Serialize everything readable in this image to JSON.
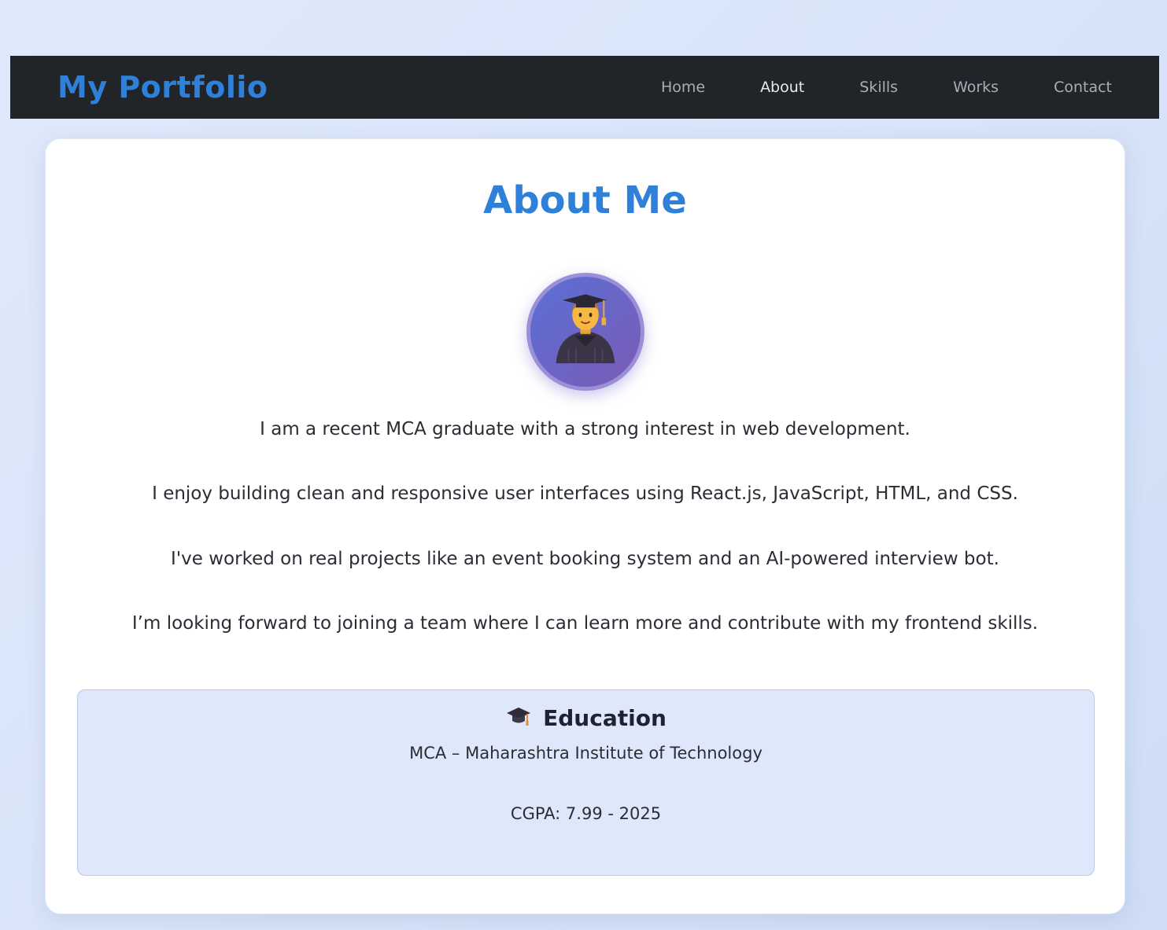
{
  "nav": {
    "brand": "My Portfolio",
    "links": [
      {
        "label": "Home",
        "active": false
      },
      {
        "label": "About",
        "active": true
      },
      {
        "label": "Skills",
        "active": false
      },
      {
        "label": "Works",
        "active": false
      },
      {
        "label": "Contact",
        "active": false
      }
    ]
  },
  "about": {
    "title": "About Me",
    "avatar_icon": "graduate-avatar-icon",
    "paragraphs": [
      "I am a recent MCA graduate with a strong interest in web development.",
      "I enjoy building clean and responsive user interfaces using React.js, JavaScript, HTML, and CSS.",
      "I've worked on real projects like an event booking system and an AI-powered interview bot.",
      "I’m looking forward to joining a team where I can learn more and contribute with my frontend skills."
    ]
  },
  "education": {
    "icon": "graduation-cap-icon",
    "title": "Education",
    "degree": "MCA – Maharashtra Institute of Technology",
    "cgpa": "CGPA: 7.99 - 2025"
  },
  "colors": {
    "accent": "#2f80d8",
    "navbar_bg": "#212428",
    "education_bg": "#dfe8fb"
  }
}
